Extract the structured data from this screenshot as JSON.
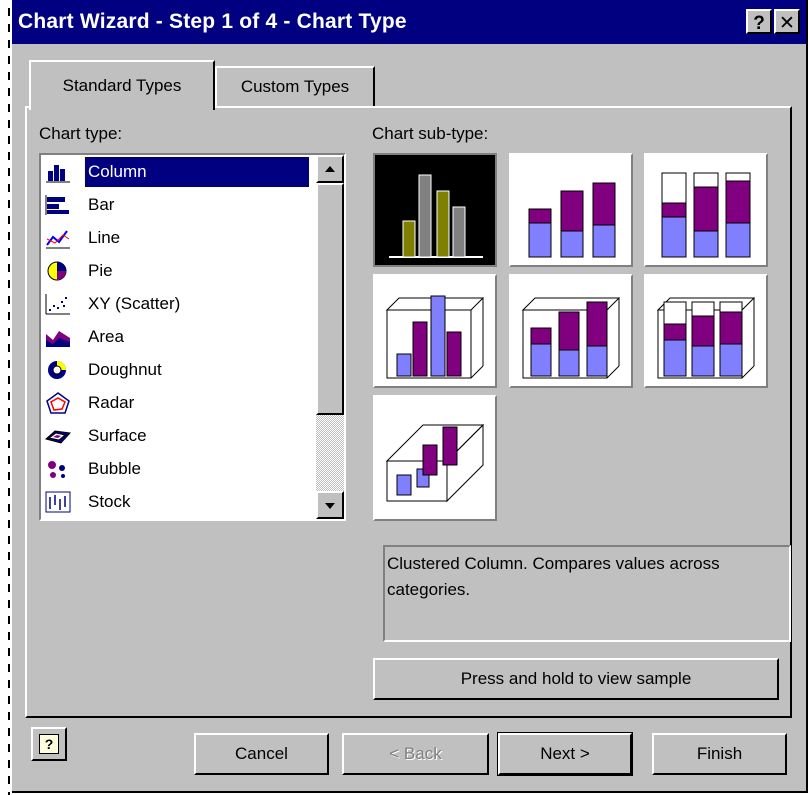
{
  "window": {
    "title": "Chart Wizard - Step 1 of 4 - Chart Type",
    "help_glyph": "?",
    "close_glyph": "✕"
  },
  "tabs": [
    {
      "label": "Standard Types",
      "active": true
    },
    {
      "label": "Custom Types",
      "active": false
    }
  ],
  "chart_type": {
    "label": "Chart type:",
    "items": [
      {
        "label": "Column",
        "icon": "column-chart-icon",
        "selected": true
      },
      {
        "label": "Bar",
        "icon": "bar-chart-icon"
      },
      {
        "label": "Line",
        "icon": "line-chart-icon"
      },
      {
        "label": "Pie",
        "icon": "pie-chart-icon"
      },
      {
        "label": "XY (Scatter)",
        "icon": "scatter-chart-icon"
      },
      {
        "label": "Area",
        "icon": "area-chart-icon"
      },
      {
        "label": "Doughnut",
        "icon": "doughnut-chart-icon"
      },
      {
        "label": "Radar",
        "icon": "radar-chart-icon"
      },
      {
        "label": "Surface",
        "icon": "surface-chart-icon"
      },
      {
        "label": "Bubble",
        "icon": "bubble-chart-icon"
      },
      {
        "label": "Stock",
        "icon": "stock-chart-icon"
      }
    ]
  },
  "chart_subtype": {
    "label": "Chart sub-type:",
    "selected_index": 0,
    "options": [
      "clustered-column-icon",
      "stacked-column-icon",
      "100-percent-stacked-column-icon",
      "clustered-3d-column-icon",
      "stacked-3d-column-icon",
      "100-percent-stacked-3d-column-icon",
      "3d-column-icon"
    ]
  },
  "description": "Clustered Column. Compares values across categories.",
  "buttons": {
    "preview": "Press and hold to view sample",
    "help_glyph": "?",
    "cancel": "Cancel",
    "back": "< Back",
    "next": "Next >",
    "finish": "Finish"
  },
  "colors": {
    "titlebar": "#000080",
    "face": "#c0c0c0",
    "series_olive": "#808000",
    "series_gray": "#808080",
    "series_periwinkle": "#8080ff",
    "series_purple": "#800080"
  }
}
